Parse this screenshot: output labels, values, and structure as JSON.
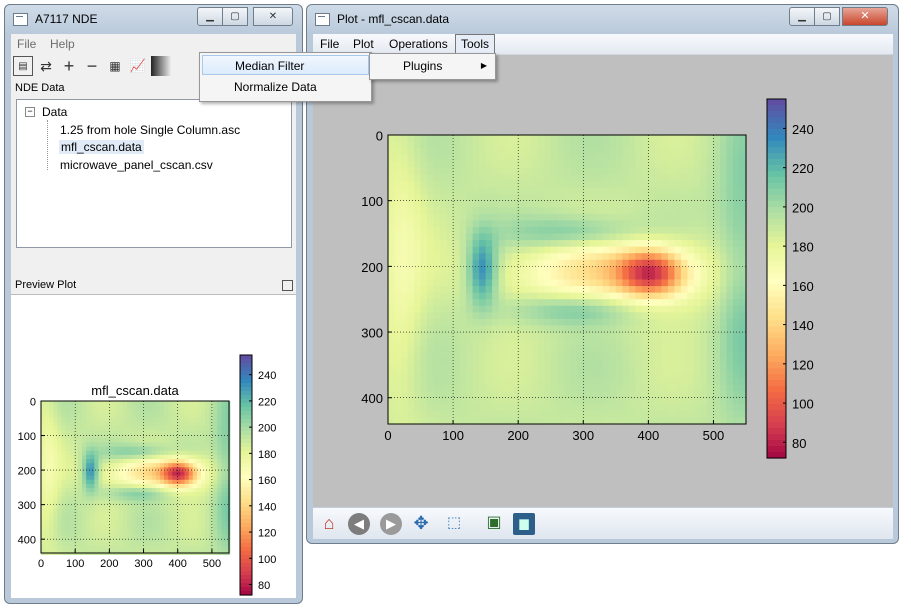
{
  "main_window": {
    "title": "A7117 NDE",
    "menu": [
      "File",
      "Help"
    ],
    "tools_menu": [
      "Median Filter",
      "Normalize Data"
    ],
    "nde_panel_title": "NDE Data",
    "tree_root": "Data",
    "tree_items": [
      "1.25 from hole Single Column.asc",
      "mfl_cscan.data",
      "microwave_panel_cscan.csv"
    ],
    "selected_item": "mfl_cscan.data",
    "preview_panel_title": "Preview Plot",
    "preview_title": "mfl_cscan.data"
  },
  "plot_window": {
    "title": "Plot - mfl_cscan.data",
    "menu": [
      "File",
      "Plot",
      "Operations",
      "Tools"
    ],
    "tools_submenu": [
      "Plugins"
    ],
    "toolbar_icons": [
      "home-icon",
      "back-arrow-icon",
      "forward-arrow-icon",
      "pan-icon",
      "zoom-icon",
      "subplots-icon",
      "save-icon"
    ]
  },
  "chart_data": [
    {
      "type": "heatmap",
      "title": "",
      "x_ticks": [
        0,
        100,
        200,
        300,
        400,
        500
      ],
      "y_ticks": [
        0,
        100,
        200,
        300,
        400
      ],
      "xlim": [
        0,
        550
      ],
      "ylim": [
        440,
        0
      ],
      "colorbar_ticks": [
        80,
        100,
        120,
        140,
        160,
        180,
        200,
        220,
        240
      ],
      "colorbar_range": [
        72,
        255
      ],
      "colormap": "Spectral",
      "grid": true,
      "features": [
        {
          "kind": "min",
          "x": 405,
          "y": 210,
          "value": 72
        },
        {
          "kind": "max",
          "x": 145,
          "y": 205,
          "value": 245
        },
        {
          "kind": "max-band",
          "x": 535,
          "y": 170,
          "value": 240
        }
      ]
    },
    {
      "type": "heatmap",
      "title": "mfl_cscan.data",
      "x_ticks": [
        0,
        100,
        200,
        300,
        400,
        500
      ],
      "y_ticks": [
        0,
        100,
        200,
        300,
        400
      ],
      "xlim": [
        0,
        550
      ],
      "ylim": [
        440,
        0
      ],
      "colorbar_ticks": [
        80,
        100,
        120,
        140,
        160,
        180,
        200,
        220,
        240
      ],
      "colorbar_range": [
        72,
        255
      ],
      "colormap": "Spectral",
      "grid": true
    }
  ],
  "colors": {
    "spectral_low": "#9e0142",
    "spectral_mid": "#ffffbf",
    "spectral_high": "#5e4fa2",
    "plot_background": "#bfbfbf"
  }
}
